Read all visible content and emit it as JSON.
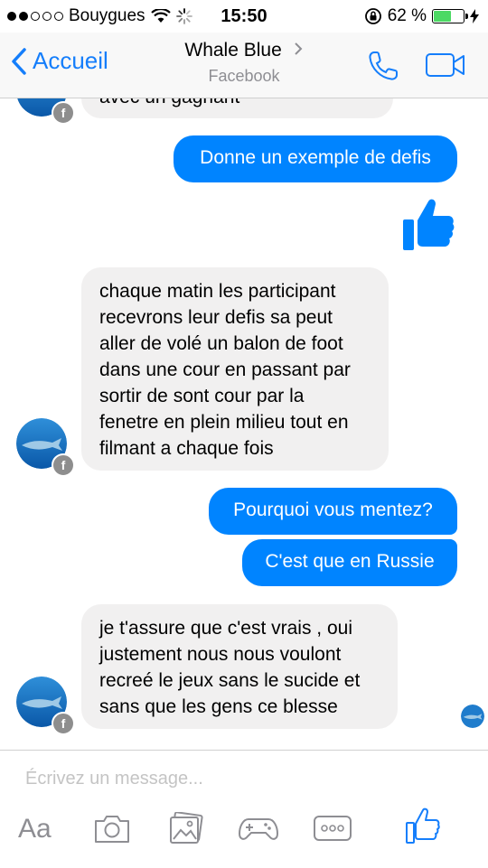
{
  "status_bar": {
    "carrier": "Bouygues",
    "time": "15:50",
    "battery": "62 %",
    "battery_level": 0.62
  },
  "header": {
    "back_label": "Accueil",
    "contact_name": "Whale Blue",
    "subtitle": "Facebook"
  },
  "messages": {
    "partial_incoming": "avec un gagnant",
    "out_1": "Donne un exemple de defis",
    "in_1": [
      "chaque matin les participant",
      "recevrons leur defis sa peut",
      "aller de volé un balon de foot",
      "dans une cour en passant par",
      "sortir de sont cour par la",
      "fenetre en plein milieu tout en",
      "filmant a chaque fois"
    ],
    "out_2": "Pourquoi vous mentez?",
    "out_3": "C'est que en Russie",
    "in_2": [
      "je t'assure que c'est vrais , oui",
      "justement nous nous voulont",
      "recreé le jeux sans le sucide et",
      "sans que les gens ce blesse"
    ]
  },
  "composer": {
    "placeholder": "Écrivez un message...",
    "text_button": "Aa"
  },
  "colors": {
    "accent": "#0084ff",
    "ios_blue": "#157efb",
    "incoming_bubble": "#f1f0f0"
  },
  "icons": {
    "back": "chevron-left-icon",
    "call": "phone-icon",
    "video": "video-camera-icon",
    "like": "thumbs-up-icon",
    "camera": "camera-icon",
    "gallery": "photo-gallery-icon",
    "games": "gamepad-icon",
    "more": "more-icon"
  }
}
